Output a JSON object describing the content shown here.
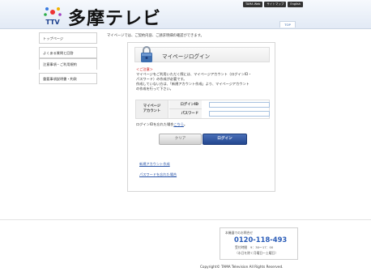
{
  "header": {
    "logo_mark": "TTV",
    "logo_text": "多摩テレビ",
    "top_links": [
      "TAMA Web",
      "サイトマップ",
      "English"
    ],
    "tab": "TOP"
  },
  "sidebar": {
    "items": [
      {
        "label": "トップページ"
      },
      {
        "label": "よくある質問と回答"
      },
      {
        "label": "注意事項・ご利用規約"
      },
      {
        "label": "重要事項説明書・約款"
      }
    ]
  },
  "intro": "マイページでは、ご契約内容、ご請求明細の確認ができます。",
  "panel": {
    "title": "マイページログイン",
    "note_heading": "＜ご注意＞",
    "notes": [
      "マイページをご利用いただく際には、マイページアカウント（ログインID・",
      "パスワード）の作成が必要です。",
      "作成していない方は、「新規アカウント作成」より、マイページアカウント",
      "の作成を行って下さい。"
    ],
    "form_label": [
      "マイページ",
      "アカウント"
    ],
    "login_id_label": "ログインID",
    "password_label": "パスワード",
    "login_id_value": "",
    "password_value": "",
    "forgot_text": "ログインIDを忘れた場合",
    "forgot_link": "こちら",
    "forgot_suffix": "。",
    "clear_button": "クリア",
    "login_button": "ログイン",
    "new_account_link": "新規アカウント作成",
    "forgot_password_link": "パスワードを忘れた場合"
  },
  "footer": {
    "contact_title": "本機器でのお問合せ",
    "phone": "0120-118-493",
    "hours": "受付時間　9：30〜17：00",
    "days": "（水日を除く月曜日〜土曜日）",
    "copyright": "Copyright© TAMA Television All Rights Reserved."
  },
  "colors": {
    "accent": "#23478f",
    "link": "#2a55a8",
    "warning": "#cc0000",
    "phone": "#2a5cb8"
  }
}
